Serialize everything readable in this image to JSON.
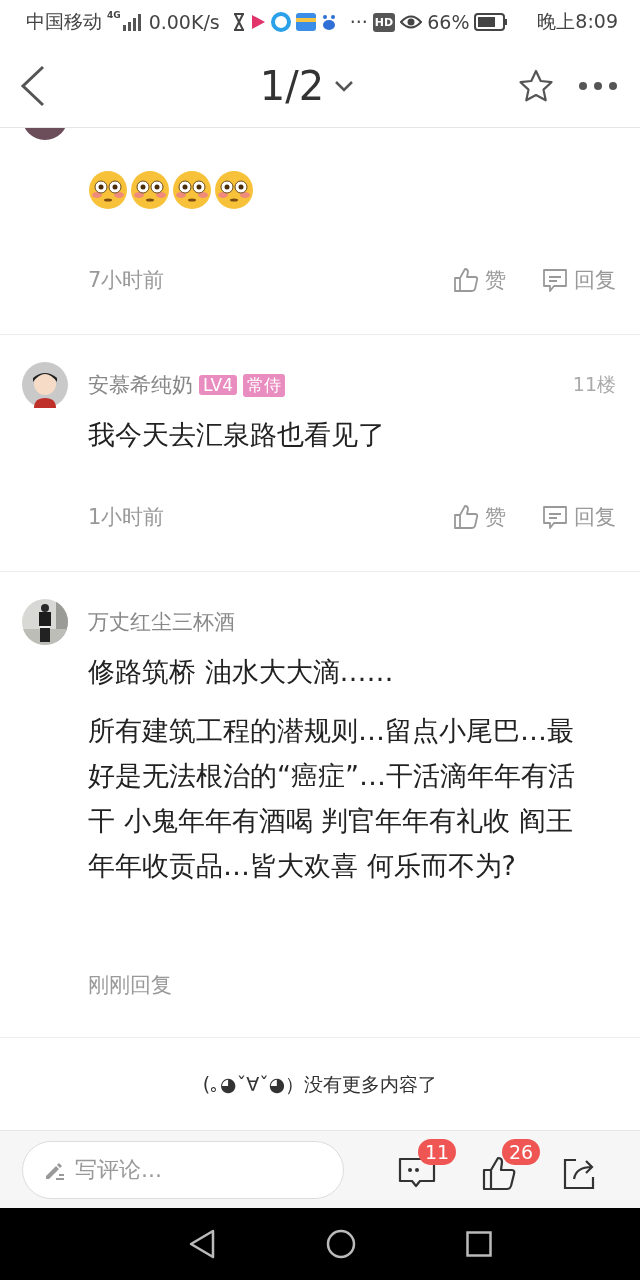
{
  "status_bar": {
    "carrier": "中国移动",
    "network": "4G",
    "speed": "0.00K/s",
    "more": "···",
    "hd": "HD",
    "battery": "66%",
    "time": "晚上8:09"
  },
  "header": {
    "page": "1/2"
  },
  "comments": [
    {
      "kind": "cut",
      "time": "7小时前",
      "like": "赞",
      "reply": "回复"
    },
    {
      "kind": "full",
      "user": "安慕希纯奶",
      "badges": [
        "LV4",
        "常侍"
      ],
      "floor": "11楼",
      "body": [
        "我今天去汇泉路也看见了"
      ],
      "time": "1小时前",
      "like": "赞",
      "reply": "回复"
    },
    {
      "user": "万丈红尘三杯酒",
      "body": [
        "修路筑桥 油水大大滴……",
        "所有建筑工程的潜规则…留点小尾巴…最好是无法根治的“癌症”…干活滴年年有活干 小鬼年年有酒喝 判官年年有礼收 阎王年年收贡品…皆大欢喜 何乐而不为?"
      ],
      "time": "刚刚回复"
    }
  ],
  "end_note": "(｡◕ˇ∀ˇ◕）没有更多内容了",
  "bottom_bar": {
    "placeholder": "写评论...",
    "comment_count": "11",
    "like_count": "26"
  }
}
